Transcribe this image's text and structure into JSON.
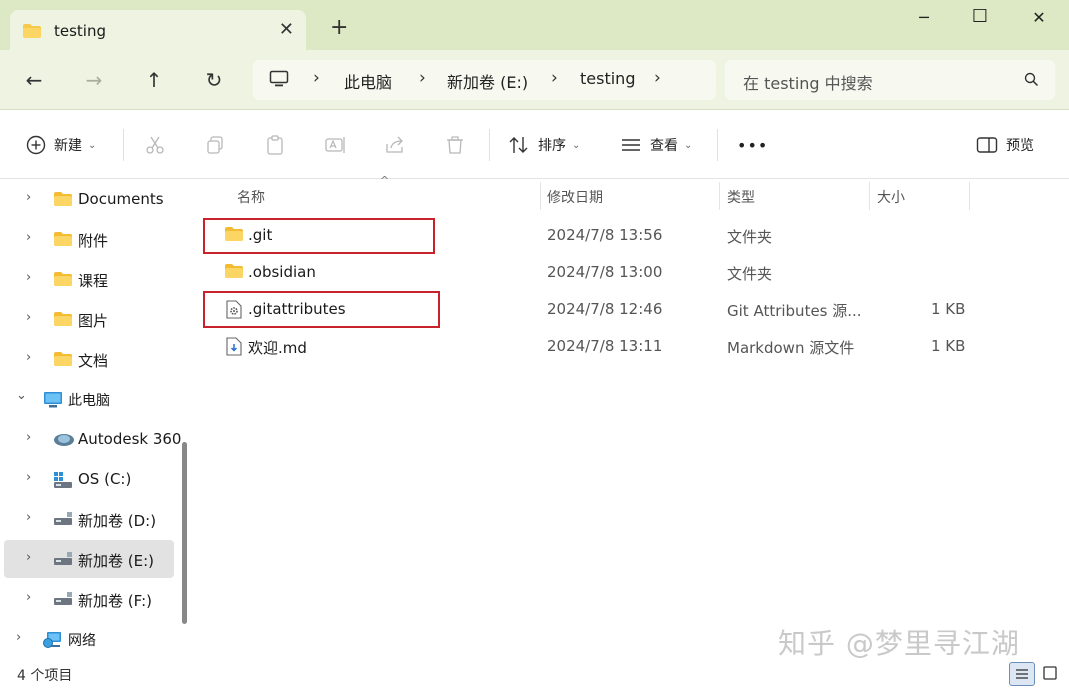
{
  "window": {
    "tab_title": "testing",
    "tab_close": "✕",
    "new_tab": "+",
    "minimize": "─",
    "maximize": "☐",
    "close": "✕"
  },
  "nav": {
    "back": "←",
    "forward": "→",
    "up": "↑",
    "refresh": "↻",
    "breadcrumb": [
      "此电脑",
      "新加卷 (E:)",
      "testing"
    ],
    "separator": "›",
    "search_placeholder": "在 testing 中搜索"
  },
  "toolbar": {
    "new_label": "新建",
    "sort_label": "排序",
    "view_label": "查看",
    "more_label": "•••",
    "preview_label": "预览",
    "caret": "⌄"
  },
  "sidebar": {
    "chevron_right": "›",
    "chevron_down": "⌄",
    "items": [
      {
        "label": "Documents",
        "icon": "folder-icon"
      },
      {
        "label": "附件",
        "icon": "folder-icon"
      },
      {
        "label": "课程",
        "icon": "folder-icon"
      },
      {
        "label": "图片",
        "icon": "folder-icon"
      },
      {
        "label": "文档",
        "icon": "folder-icon"
      },
      {
        "label": "此电脑",
        "icon": "computer-icon",
        "expanded": true
      },
      {
        "label": "Autodesk 360",
        "icon": "cloud-drive-icon"
      },
      {
        "label": "OS (C:)",
        "icon": "system-drive-icon"
      },
      {
        "label": "新加卷 (D:)",
        "icon": "drive-icon"
      },
      {
        "label": "新加卷 (E:)",
        "icon": "drive-icon",
        "selected": true
      },
      {
        "label": "新加卷 (F:)",
        "icon": "drive-icon"
      },
      {
        "label": "网络",
        "icon": "network-icon"
      }
    ]
  },
  "files": {
    "sort_indicator": "^",
    "columns": [
      "名称",
      "修改日期",
      "类型",
      "大小"
    ],
    "rows": [
      {
        "name": ".git",
        "date": "2024/7/8 13:56",
        "type": "文件夹",
        "size": "",
        "icon": "folder-icon",
        "highlighted": true
      },
      {
        "name": ".obsidian",
        "date": "2024/7/8 13:00",
        "type": "文件夹",
        "size": "",
        "icon": "folder-icon",
        "highlighted": false
      },
      {
        "name": ".gitattributes",
        "date": "2024/7/8 12:46",
        "type": "Git Attributes 源...",
        "size": "1 KB",
        "icon": "settings-file-icon",
        "highlighted": true
      },
      {
        "name": "欢迎.md",
        "date": "2024/7/8 13:11",
        "type": "Markdown 源文件",
        "size": "1 KB",
        "icon": "markdown-file-icon",
        "highlighted": false
      }
    ]
  },
  "status": {
    "item_count": "4 个项目"
  },
  "watermark": "知乎 @梦里寻江湖",
  "colors": {
    "titlebar": "#dde8c4",
    "navbar": "#eef3e2",
    "folder": "#f7c94b",
    "highlight": "#c8232c",
    "selected": "#e2e2e2"
  }
}
